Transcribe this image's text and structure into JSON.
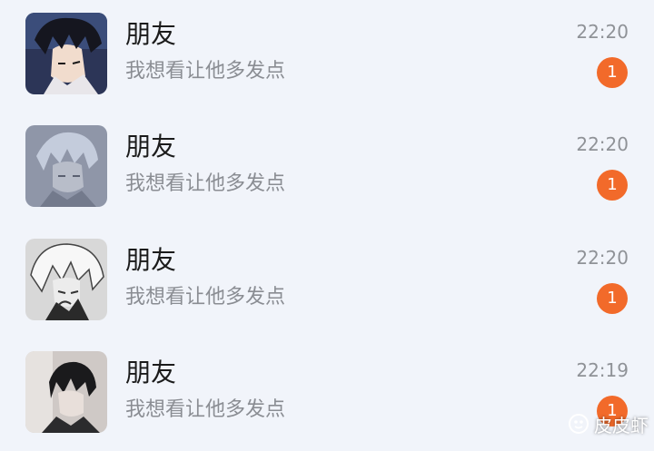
{
  "conversations": [
    {
      "name": "朋友",
      "preview": "我想看让他多发点",
      "time": "22:20",
      "unread": "1",
      "avatar_icon": "anime-boy-dark-hair-avatar"
    },
    {
      "name": "朋友",
      "preview": "我想看让他多发点",
      "time": "22:20",
      "unread": "1",
      "avatar_icon": "anime-boy-pale-blue-avatar"
    },
    {
      "name": "朋友",
      "preview": "我想看让他多发点",
      "time": "22:20",
      "unread": "1",
      "avatar_icon": "anime-boy-white-hair-avatar"
    },
    {
      "name": "朋友",
      "preview": "我想看让他多发点",
      "time": "22:19",
      "unread": "1",
      "avatar_icon": "anime-boy-black-hair-avatar"
    }
  ],
  "watermark": {
    "text": "皮皮虾",
    "icon": "pipixia-logo-icon"
  },
  "colors": {
    "background": "#f1f4fa",
    "badge": "#f26a2a",
    "name": "#1b1b1b",
    "preview": "#8a8d93",
    "time": "#8f9297"
  }
}
